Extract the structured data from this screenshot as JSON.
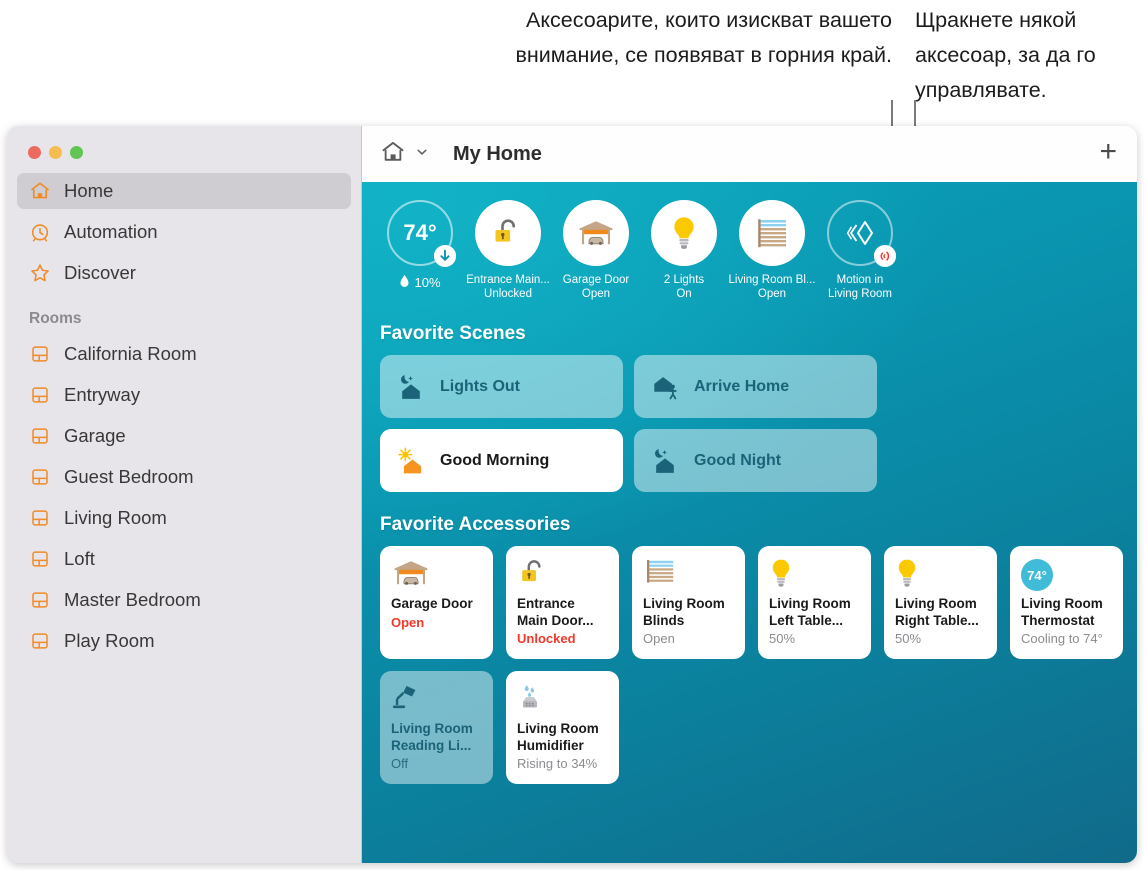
{
  "callouts": {
    "left": "Аксесоарите, които изискват вашето внимание, се появяват в горния край.",
    "right": "Щракнете някой аксесоар, за да го управлявате."
  },
  "window": {
    "traffic_lights": [
      "close",
      "minimize",
      "zoom"
    ]
  },
  "sidebar": {
    "items": [
      {
        "label": "Home",
        "icon": "home-icon",
        "selected": true
      },
      {
        "label": "Automation",
        "icon": "clock-icon",
        "selected": false
      },
      {
        "label": "Discover",
        "icon": "star-icon",
        "selected": false
      }
    ],
    "rooms_header": "Rooms",
    "rooms": [
      {
        "label": "California Room",
        "icon": "room-icon"
      },
      {
        "label": "Entryway",
        "icon": "room-icon"
      },
      {
        "label": "Garage",
        "icon": "room-icon"
      },
      {
        "label": "Guest Bedroom",
        "icon": "room-icon"
      },
      {
        "label": "Living Room",
        "icon": "room-icon"
      },
      {
        "label": "Loft",
        "icon": "room-icon"
      },
      {
        "label": "Master Bedroom",
        "icon": "room-icon"
      },
      {
        "label": "Play Room",
        "icon": "room-icon"
      }
    ]
  },
  "toolbar": {
    "home_icon": "home-icon",
    "chevron": "chevron-down-icon",
    "title": "My Home",
    "add_label": "+"
  },
  "status_strip": [
    {
      "kind": "climate",
      "value": "74°",
      "humidity": "10%",
      "humidity_icon": "droplet-icon",
      "badge": "arrow-down-icon",
      "label": "",
      "sub": ""
    },
    {
      "kind": "lock",
      "icon": "unlocked-padlock-icon",
      "label": "Entrance Main...",
      "sub": "Unlocked"
    },
    {
      "kind": "garage",
      "icon": "garage-door-icon",
      "label": "Garage Door",
      "sub": "Open"
    },
    {
      "kind": "light",
      "icon": "lightbulb-icon",
      "label": "2 Lights",
      "sub": "On"
    },
    {
      "kind": "blinds",
      "icon": "blinds-icon",
      "label": "Living Room Bl...",
      "sub": "Open"
    },
    {
      "kind": "motion",
      "icon": "motion-sensor-icon",
      "badge": "signal-icon",
      "label": "Motion in",
      "sub": "Living Room"
    }
  ],
  "scenes": {
    "title": "Favorite Scenes",
    "items": [
      {
        "name": "Lights Out",
        "icon": "moon-house-icon",
        "active": false
      },
      {
        "name": "Arrive Home",
        "icon": "house-person-icon",
        "active": false
      },
      {
        "name": "Good Morning",
        "icon": "sun-house-icon",
        "active": true
      },
      {
        "name": "Good Night",
        "icon": "moon-house-icon",
        "active": false
      }
    ]
  },
  "accessories": {
    "title": "Favorite Accessories",
    "items": [
      {
        "name": "Garage Door",
        "state": "Open",
        "icon": "garage-door-icon",
        "alert": true,
        "off": false
      },
      {
        "name": "Entrance Main Door...",
        "state": "Unlocked",
        "icon": "unlocked-padlock-icon",
        "alert": true,
        "off": false
      },
      {
        "name": "Living Room Blinds",
        "state": "Open",
        "icon": "blinds-icon",
        "alert": false,
        "off": false
      },
      {
        "name": "Living Room Left Table...",
        "state": "50%",
        "icon": "lightbulb-icon",
        "alert": false,
        "off": false
      },
      {
        "name": "Living Room Right Table...",
        "state": "50%",
        "icon": "lightbulb-icon",
        "alert": false,
        "off": false
      },
      {
        "name": "Living Room Thermostat",
        "state": "Cooling to 74°",
        "icon": "thermostat-icon",
        "chip": "74°",
        "alert": false,
        "off": false
      },
      {
        "name": "Living Room Reading Li...",
        "state": "Off",
        "icon": "desk-lamp-icon",
        "alert": false,
        "off": true
      },
      {
        "name": "Living Room Humidifier",
        "state": "Rising to 34%",
        "icon": "humidifier-icon",
        "alert": false,
        "off": false
      }
    ]
  },
  "colors": {
    "accent_orange": "#ef8b28",
    "bg_teal_light": "#0ba4bb",
    "bg_teal_dark": "#116a8a",
    "alert_red": "#f2392b",
    "scene_text": "#1b6378",
    "sidebar_bg": "#e7e5ea"
  }
}
